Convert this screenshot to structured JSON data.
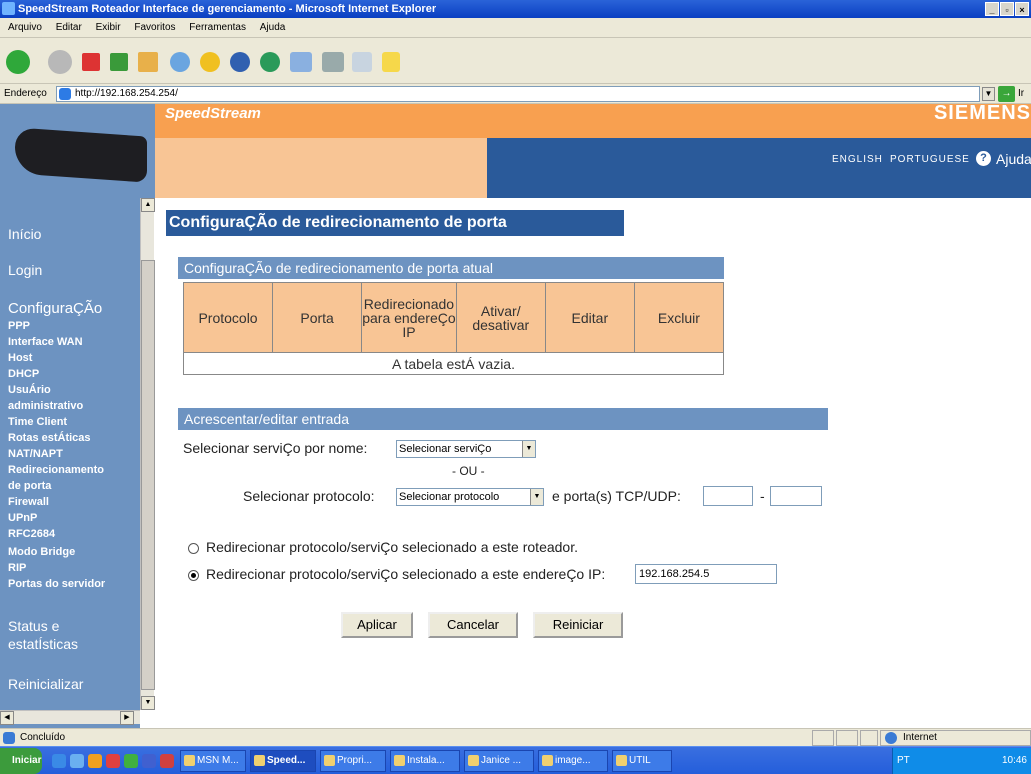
{
  "window": {
    "title": "SpeedStream Roteador Interface de gerenciamento - Microsoft Internet Explorer",
    "min": "_",
    "max": "▫",
    "close": "×"
  },
  "menu": [
    "Arquivo",
    "Editar",
    "Exibir",
    "Favoritos",
    "Ferramentas",
    "Ajuda"
  ],
  "address": {
    "label": "Endereço",
    "url": "http://192.168.254.254/",
    "go": "→",
    "go_label": "Ir"
  },
  "header": {
    "brand": "SpeedStream",
    "vendor": "SIEMENS",
    "lang_en": "ENGLISH",
    "lang_pt": "PORTUGUESE",
    "help": "Ajuda"
  },
  "sidebar": {
    "inicio": "Início",
    "login": "Login",
    "config": "ConfiguraÇÃo",
    "items": [
      "PPP",
      "Interface WAN",
      "Host",
      "DHCP",
      "UsuÁrio",
      "administrativo",
      "Time Client",
      "Rotas estÁticas",
      "NAT/NAPT",
      "Redirecionamento",
      "de porta",
      "Firewall",
      "UPnP",
      "RFC2684",
      "Modo Bridge",
      "RIP",
      "Portas do servidor"
    ],
    "status1": "Status e",
    "status2": "estatÍsticas",
    "reinit": "Reinicializar"
  },
  "main": {
    "title": "ConfiguraÇÃo de redirecionamento de porta",
    "current_title": "ConfiguraÇÃo de redirecionamento de porta atual",
    "table_headers": [
      "Protocolo",
      "Porta",
      "Redirecionado para endereÇo IP",
      "Ativar/ desativar",
      "Editar",
      "Excluir"
    ],
    "empty": "A tabela estÁ vazia.",
    "add_title": "Acrescentar/editar entrada",
    "service_label": "Selecionar serviÇo por nome:",
    "service_value": "Selecionar serviÇo",
    "or": "- OU -",
    "protocol_label": "Selecionar protocolo:",
    "protocol_value": "Selecionar protocolo",
    "ports_label": "e porta(s) TCP/UDP:",
    "port_sep": "-",
    "radio1": "Redirecionar protocolo/serviÇo selecionado a este roteador.",
    "radio2": "Redirecionar protocolo/serviÇo selecionado a este endereÇo IP:",
    "ip_value": "192.168.254.5",
    "btn_apply": "Aplicar",
    "btn_cancel": "Cancelar",
    "btn_restart": "Reiniciar"
  },
  "status": {
    "text": "Concluído",
    "zone": "Internet"
  },
  "taskbar": {
    "start": "Iniciar",
    "tasks": [
      "MSN M...",
      "Speed...",
      "Propri...",
      "Instala...",
      "Janice ...",
      "image...",
      "UTIL"
    ],
    "clock": "10:46",
    "tray_lang": "PT"
  },
  "colors": {
    "sidebar": "#6d93c1",
    "header_orange": "#f8a050",
    "header_blue": "#2a5a9a",
    "table_header": "#f8c595"
  }
}
